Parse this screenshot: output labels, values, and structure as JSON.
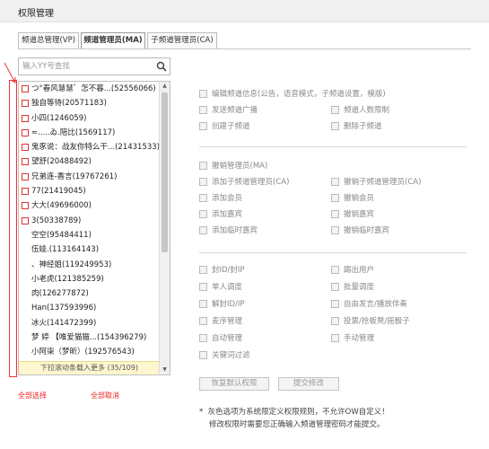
{
  "page": {
    "title": "权限管理"
  },
  "tabs": [
    {
      "label": "频道总管理(VP)",
      "active": false
    },
    {
      "label": "频道管理员(MA)",
      "active": true
    },
    {
      "label": "子频道管理员(CA)",
      "active": false
    }
  ],
  "search": {
    "placeholder": "输入YY号查找",
    "value": ""
  },
  "members": [
    "つ°春风慧慧゛怎不暮...(52556066)",
    "独自等待(20571183)",
    "小四(1246059)",
    "≈.....ゐ.陪比(1569117)",
    "鬼豕说：战友你特么干...(21431533)",
    "望舒(20488492)",
    "兄弟连-香言(19767261)",
    "77(21419045)",
    "大大(49696000)",
    "3(50338789)",
    "空空(95484411)",
    "伍娃.(113164143)",
    "、神经姐(119249953)",
    "小老虎(121385259)",
    "肉(126277872)",
    "Han(137593996)",
    "冰火(141472399)",
    "梦 婷 【唯爱猫猫...(154396279)",
    "小阿柒（梦昕）(192576543)"
  ],
  "load_more": "下拉滚动条载入更多 (35/109)",
  "annotations": {
    "select_all": "全部选择",
    "deselect_all": "全部取消"
  },
  "perm_groups": {
    "group1": [
      "编辑频道信息(公告，语音模式，子频道设置，模版)",
      "发送频道广播",
      "频道人数限制",
      "创建子频道",
      "删除子频道"
    ],
    "group2": [
      "撤销管理员(MA)",
      "添加子频道管理员(CA)",
      "撤销子频道管理员(CA)",
      "添加会员",
      "撤销会员",
      "添加嘉宾",
      "撤销嘉宾",
      "添加临时嘉宾",
      "撤销临时嘉宾"
    ],
    "group3": [
      "封ID/封IP",
      "踢出用户",
      "单人调度",
      "批量调度",
      "解封ID/IP",
      "自由发言/播放伴奏",
      "麦序管理",
      "投票/抢板凳/摇骰子",
      "自动管理",
      "手动管理",
      "关键词过滤"
    ]
  },
  "buttons": {
    "restore": "恢复默认权限",
    "submit": "提交修改"
  },
  "notes": [
    "灰色选项为系统限定义权限规则，不允许OW自定义！",
    "修改权限时需要您正确输入频道管理密码才能提交。"
  ],
  "colors": {
    "annotation": "#e33333",
    "disabled_text": "#888888"
  }
}
